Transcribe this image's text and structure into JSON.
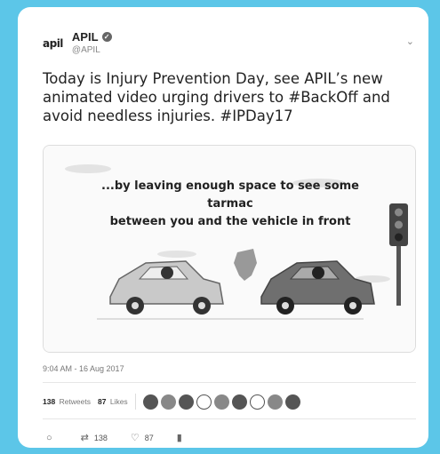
{
  "author": {
    "logo": "apil",
    "display_name": "APIL",
    "handle": "@APIL"
  },
  "tweet": {
    "text": "Today is Injury Prevention Day, see APIL’s new animated video urging drivers to #BackOff and avoid needless injuries. #IPDay17"
  },
  "media": {
    "caption_line1": "...by leaving enough space to see some tarmac",
    "caption_line2": "between you and the vehicle in front"
  },
  "timestamp": "9:04 AM - 16 Aug 2017",
  "stats": {
    "retweets_count": "138",
    "retweets_label": "Retweets",
    "likes_count": "87",
    "likes_label": "Likes"
  },
  "actions": {
    "retweet_count": "138",
    "like_count": "87"
  },
  "icons": {
    "reply": "reply-icon",
    "retweet": "retweet-icon",
    "like": "heart-icon",
    "analytics": "analytics-icon",
    "caret": "chevron-down-icon",
    "verified": "verified-badge-icon"
  }
}
